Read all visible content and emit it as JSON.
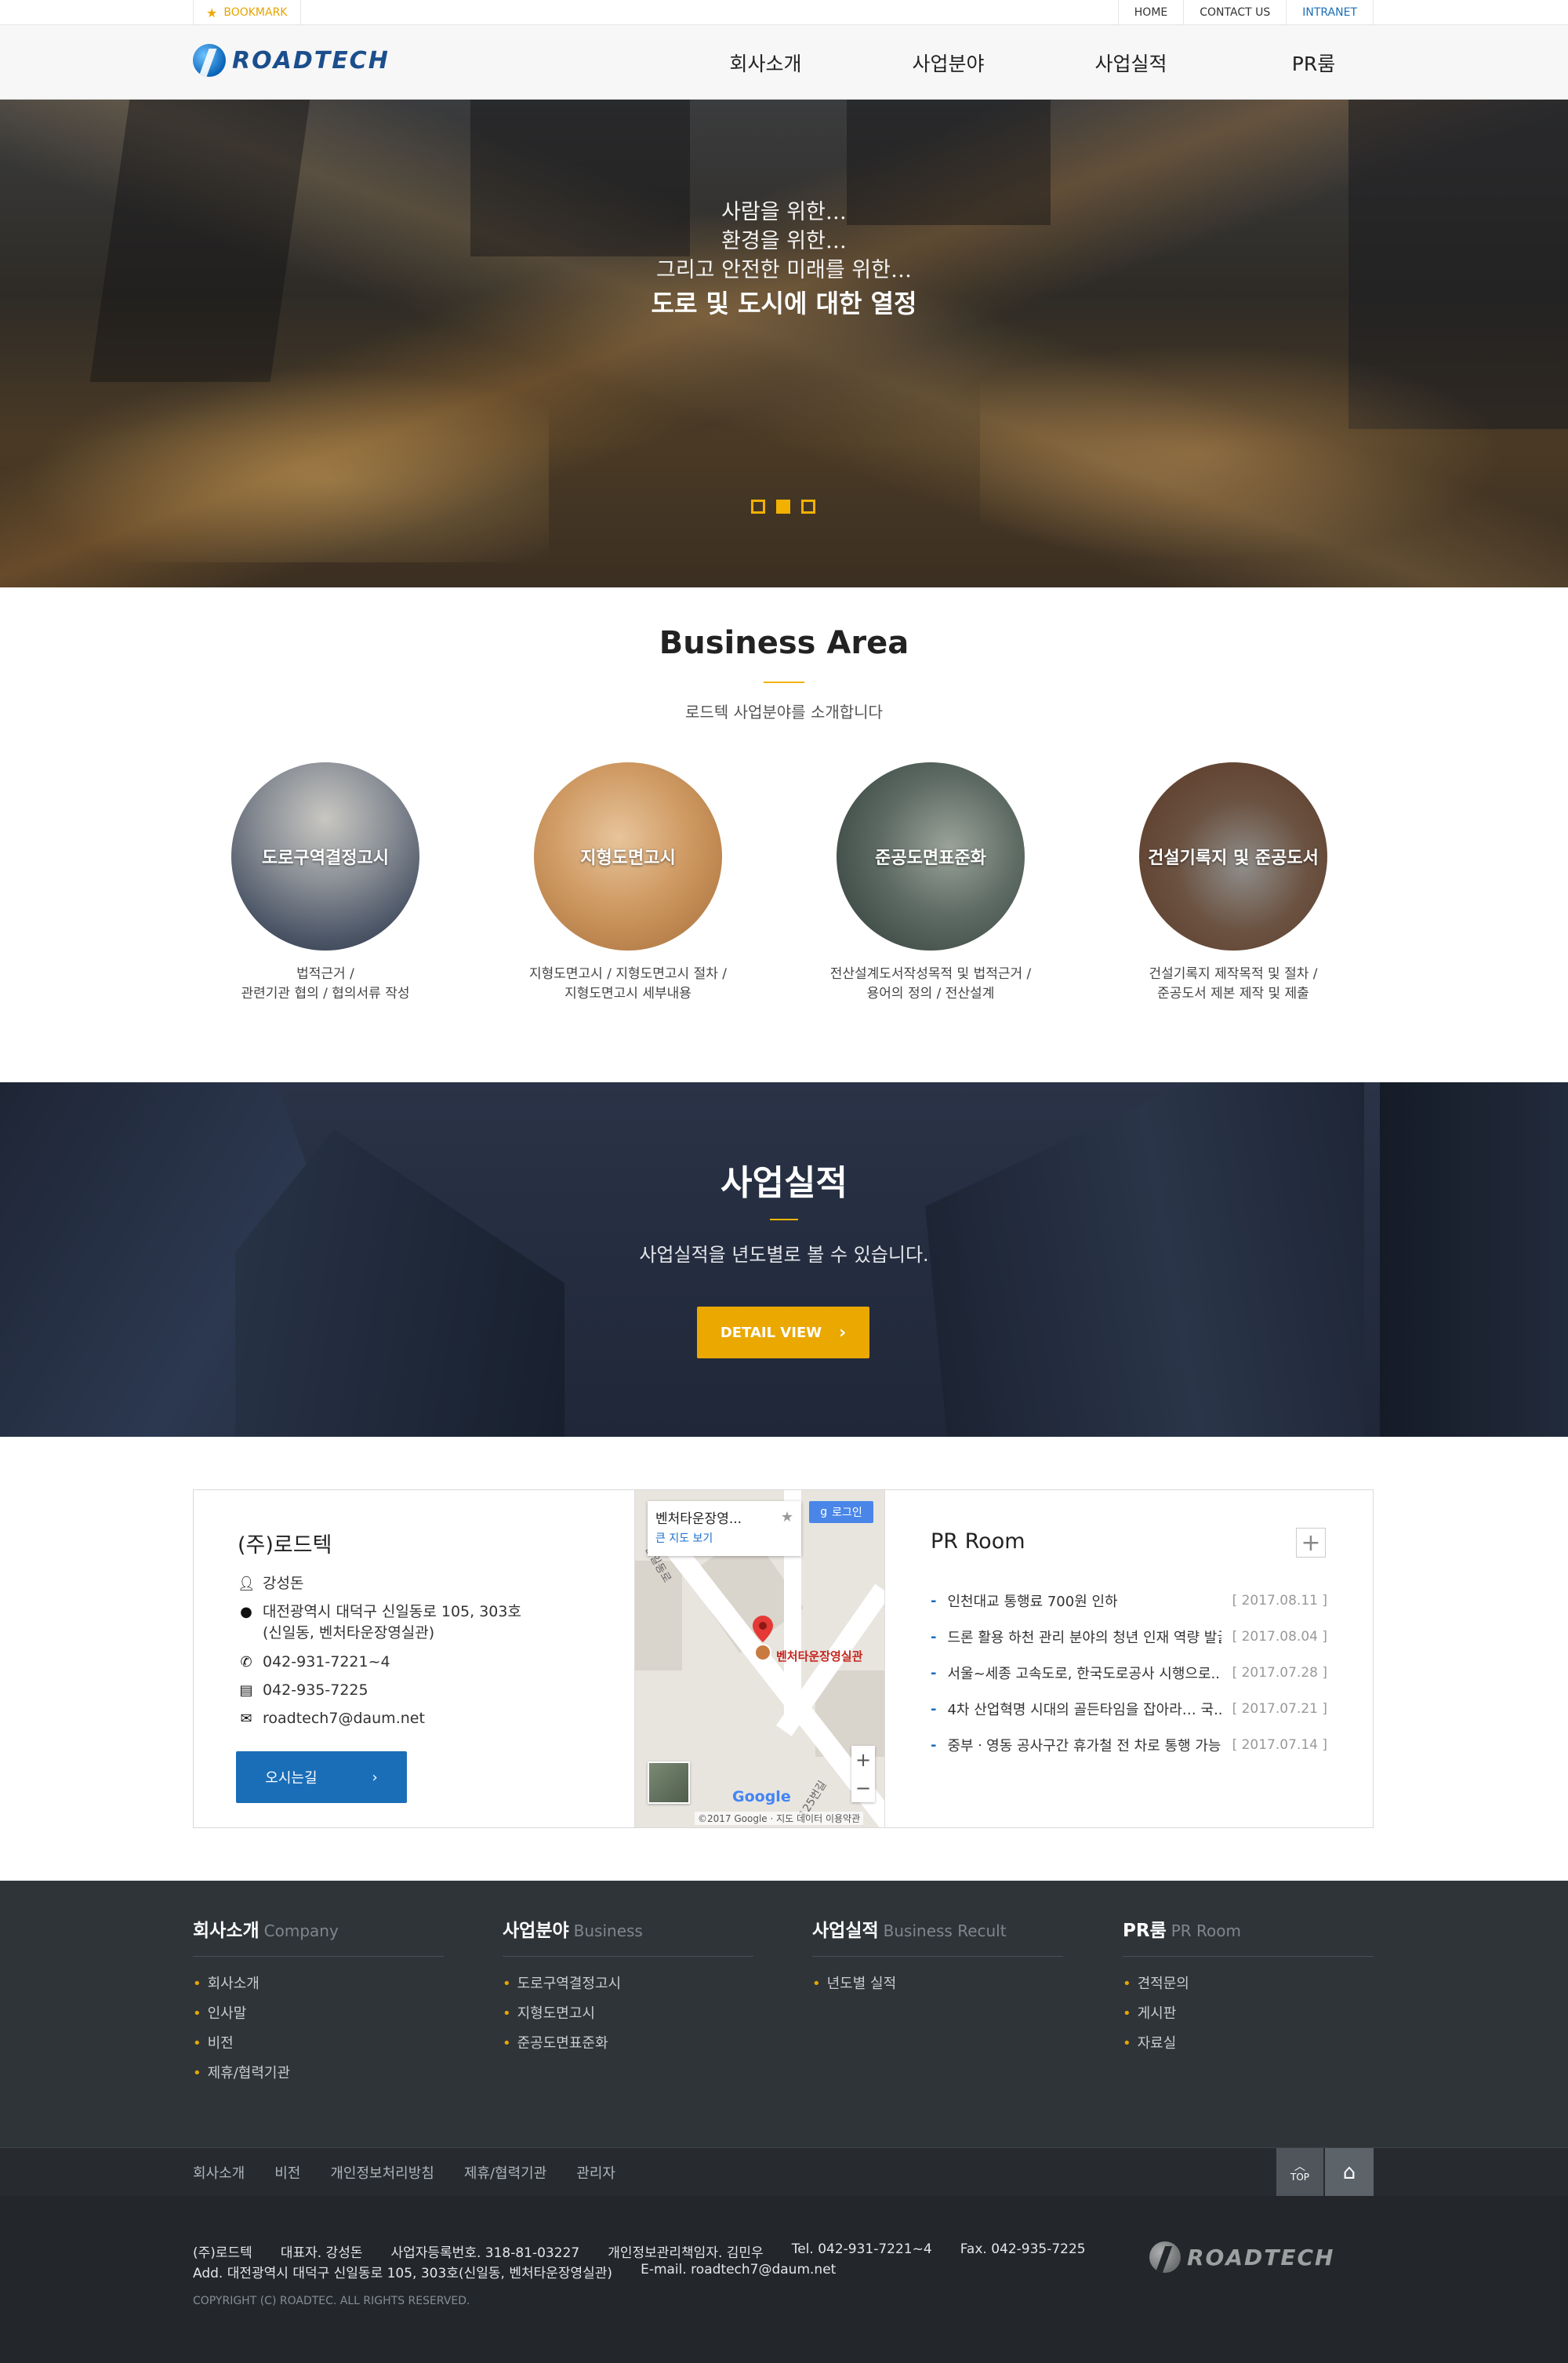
{
  "util": {
    "bookmark": "BOOKMARK",
    "links": [
      "HOME",
      "CONTACT US",
      "INTRANET"
    ]
  },
  "header": {
    "logo_text": "ROADTECH",
    "nav": [
      "회사소개",
      "사업분야",
      "사업실적",
      "PR룸"
    ]
  },
  "hero": {
    "lines": [
      "사람을 위한…",
      "환경을 위한…",
      "그리고 안전한 미래를 위한…"
    ],
    "headline": "도로 및 도시에 대한 열정",
    "slides": 3,
    "active_slide": 2
  },
  "business": {
    "title": "Business Area",
    "subtitle": "로드텍 사업분야를 소개합니다",
    "items": [
      {
        "label": "도로구역결정고시",
        "desc1": "법적근거 /",
        "desc2": "관련기관 협의 / 협의서류 작성"
      },
      {
        "label": "지형도면고시",
        "desc1": "지형도면고시 / 지형도면고시 절차 /",
        "desc2": "지형도면고시 세부내용"
      },
      {
        "label": "준공도면표준화",
        "desc1": "전산설계도서작성목적 및 법적근거 /",
        "desc2": "용어의 정의 / 전산설계"
      },
      {
        "label": "건설기록지 및 준공도서",
        "desc1": "건설기록지 제작목적 및 절차 /",
        "desc2": "준공도서 제본 제작 및 제출"
      }
    ]
  },
  "performance": {
    "title": "사업실적",
    "subtitle": "사업실적을 년도별로 볼 수 있습니다.",
    "button": "DETAIL VIEW"
  },
  "company": {
    "name": "(주)로드텍",
    "ceo": "강성돈",
    "address1": "대전광역시 대덕구 신일동로 105, 303호",
    "address2": "(신일동, 벤처타운장영실관)",
    "tel": "042-931-7221~4",
    "fax": "042-935-7225",
    "email": "roadtech7@daum.net",
    "directions": "오시는길"
  },
  "map": {
    "place": "벤처타운장영...",
    "bigger": "큰 지도 보기",
    "login": "로그인",
    "pin_label": "벤처타운장영실관",
    "street1": "신일동로",
    "street2": "125번길",
    "google": "Google",
    "copyright": "©2017 Google · 지도 데이터   이용약관"
  },
  "pr": {
    "title": "PR Room",
    "news": [
      {
        "title": "인천대교 통행료 700원 인하",
        "date": "[ 2017.08.11 ]"
      },
      {
        "title": "드론 활용 하천 관리 분야의 청년 인재 역량 발굴",
        "date": "[ 2017.08.04 ]"
      },
      {
        "title": "서울~세종 고속도로, 한국도로공사 시행으로...",
        "date": "[ 2017.07.28 ]"
      },
      {
        "title": "4차 산업혁명 시대의 골든타임을 잡아라… 국...",
        "date": "[ 2017.07.21 ]"
      },
      {
        "title": "중부ㆍ영동 공사구간 휴가철 전 차로 통행 가능",
        "date": "[ 2017.07.14 ]"
      }
    ]
  },
  "footer": {
    "cols": [
      {
        "title": "회사소개",
        "en": "Company",
        "items": [
          "회사소개",
          "인사말",
          "비전",
          "제휴/협력기관"
        ]
      },
      {
        "title": "사업분야",
        "en": "Business",
        "items": [
          "도로구역결정고시",
          "지형도면고시",
          "준공도면표준화"
        ]
      },
      {
        "title": "사업실적",
        "en": "Business Recult",
        "items": [
          "년도별 실적"
        ]
      },
      {
        "title": "PR룸",
        "en": "PR Room",
        "items": [
          "견적문의",
          "게시판",
          "자료실"
        ]
      }
    ],
    "nav": [
      "회사소개",
      "비전",
      "개인정보처리방침",
      "제휴/협력기관",
      "관리자"
    ],
    "top": "TOP",
    "line1": [
      "(주)로드텍",
      "대표자. 강성돈",
      "사업자등록번호. 318-81-03227",
      "개인정보관리책임자. 김민우",
      "Tel. 042-931-7221~4",
      "Fax. 042-935-7225"
    ],
    "line2": [
      "Add. 대전광역시 대덕구 신일동로 105, 303호(신일동, 벤처타운장영실관)",
      "E-mail. roadtech7@daum.net"
    ],
    "copyright": "COPYRIGHT (C) ROADTEC. ALL RIGHTS RESERVED.",
    "logo_text": "ROADTECH"
  },
  "colors": {
    "accent": "#f0b400",
    "brand_blue": "#1a6eb8",
    "footer_bg": "#2f3438"
  },
  "icons": {
    "bookmark": "star-icon",
    "person": "person-icon",
    "location": "pin-icon",
    "phone": "phone-icon",
    "fax": "fax-icon",
    "mail": "mail-icon",
    "home": "home-icon"
  }
}
